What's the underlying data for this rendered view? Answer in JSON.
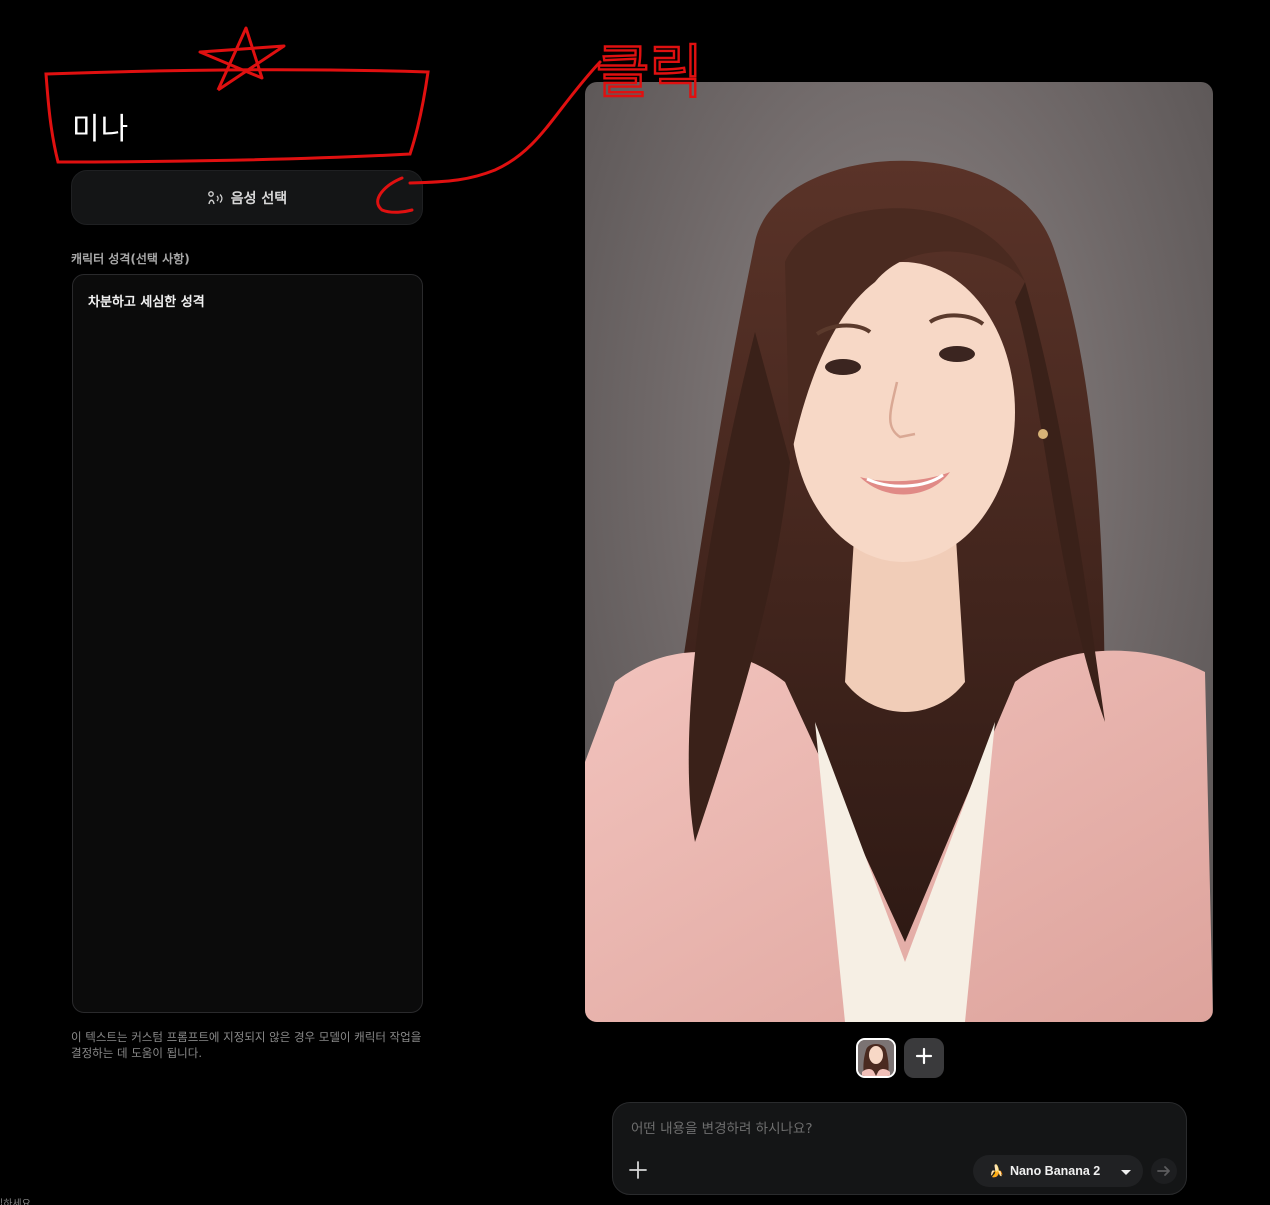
{
  "character": {
    "name": "미나"
  },
  "voice": {
    "button_label": "음성 선택",
    "icon": "voice-wave-icon"
  },
  "personality": {
    "label": "캐릭터 성격(선택 사항)",
    "value": "차분하고 세심한 성격",
    "helper": "이 텍스트는 커스텀 프롬프트에 지정되지 않은 경우 모델이 캐릭터 작업을 결정하는 데 도움이 됩니다."
  },
  "cut_off_text": "입하세요",
  "portrait": {
    "description_icon": "portrait-image"
  },
  "thumbnails": {
    "add_icon": "plus-icon"
  },
  "prompt": {
    "placeholder": "어떤 내용을 변경하려 하시나요?",
    "value": "",
    "model_emoji": "🍌",
    "model_name": "Nano Banana 2",
    "attach_icon": "plus-icon",
    "send_icon": "arrow-right-icon"
  },
  "annotation": {
    "text": "클릭",
    "color": "#e01010"
  },
  "colors": {
    "background": "#000000",
    "panel": "#141516",
    "annotation_red": "#e01010"
  }
}
